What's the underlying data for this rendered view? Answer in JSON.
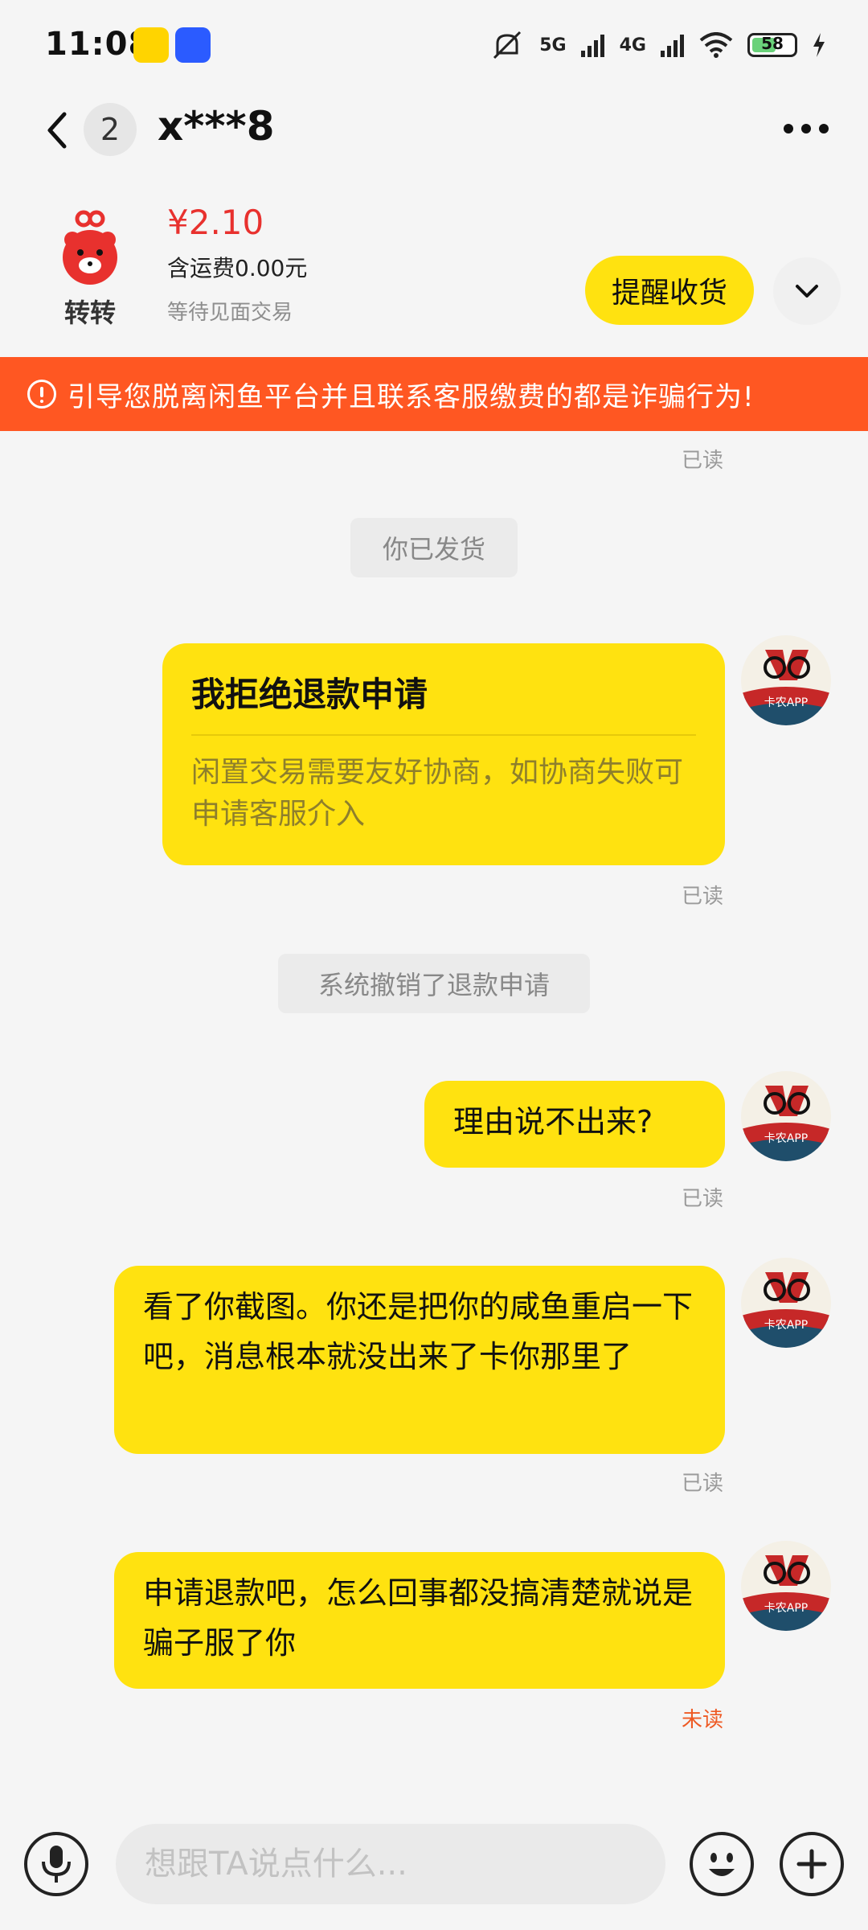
{
  "status_bar": {
    "time": "11:08",
    "net1": "5G",
    "net2": "4G",
    "battery": "58",
    "battery_level_percent": 58
  },
  "header": {
    "unread_count": "2",
    "contact_name": "x***8"
  },
  "order": {
    "platform_name": "转转",
    "price": "¥2.10",
    "shipping": "含运费0.00元",
    "status": "等待见面交易",
    "remind_button": "提醒收货"
  },
  "warning": {
    "text": "引导您脱离闲鱼平台并且联系客服缴费的都是诈骗行为!"
  },
  "chat": {
    "read_label_1": "已读",
    "system_1": "你已发货",
    "card_title": "我拒绝退款申请",
    "card_desc": "闲置交易需要友好协商，如协商失败可申请客服介入",
    "read_label_2": "已读",
    "system_2": "系统撤销了退款申请",
    "msg_1": "理由说不出来?",
    "read_label_3": "已读",
    "msg_2": "看了你截图。你还是把你的咸鱼重启一下吧，消息根本就没出来了卡你那里了",
    "read_label_4": "已读",
    "msg_3": "申请退款吧，怎么回事都没搞清楚就说是骗子服了你",
    "read_label_5": "未读",
    "avatar_text": "卡农APP"
  },
  "input": {
    "placeholder": "想跟TA说点什么..."
  },
  "colors": {
    "accent_yellow": "#ffe210",
    "warning_orange": "#ff5722",
    "price_red": "#e8312e",
    "unread_red": "#ee5a24"
  },
  "icons": [
    "back-icon",
    "more-icon",
    "chevron-down-icon",
    "warning-icon",
    "mic-icon",
    "emoji-icon",
    "plus-icon",
    "mute-icon",
    "wifi-icon",
    "signal-icon",
    "charging-icon"
  ]
}
